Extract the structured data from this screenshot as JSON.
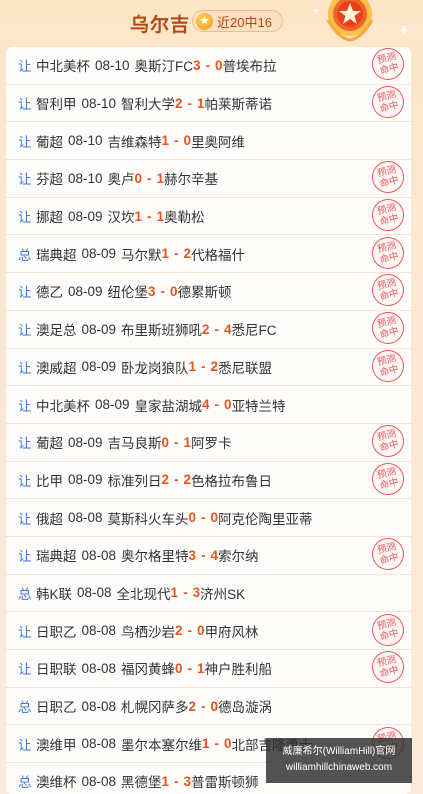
{
  "header": {
    "title": "乌尔吉",
    "badge_label": "近20中16",
    "badge_icon": "star-icon"
  },
  "rows": [
    {
      "kind": "让",
      "league": "中北美杯",
      "date": "08-10",
      "home": "奥斯汀FC",
      "hs": "3",
      "as": "0",
      "away": "普埃布拉",
      "hit": true
    },
    {
      "kind": "让",
      "league": "智利甲",
      "date": "08-10",
      "home": "智利大学",
      "hs": "2",
      "as": "1",
      "away": "帕莱斯蒂诺",
      "hit": true
    },
    {
      "kind": "让",
      "league": "葡超",
      "date": "08-10",
      "home": "吉维森特",
      "hs": "1",
      "as": "0",
      "away": "里奥阿维",
      "hit": false
    },
    {
      "kind": "让",
      "league": "芬超",
      "date": "08-10",
      "home": "奥卢",
      "hs": "0",
      "as": "1",
      "away": "赫尔辛基",
      "hit": true
    },
    {
      "kind": "让",
      "league": "挪超",
      "date": "08-09",
      "home": "汉坎",
      "hs": "1",
      "as": "1",
      "away": "奥勒松",
      "hit": true
    },
    {
      "kind": "总",
      "league": "瑞典超",
      "date": "08-09",
      "home": "马尔默",
      "hs": "1",
      "as": "2",
      "away": "代格福什",
      "hit": true
    },
    {
      "kind": "让",
      "league": "德乙",
      "date": "08-09",
      "home": "纽伦堡",
      "hs": "3",
      "as": "0",
      "away": "德累斯顿",
      "hit": true
    },
    {
      "kind": "让",
      "league": "澳足总",
      "date": "08-09",
      "home": "布里斯班狮吼",
      "hs": "2",
      "as": "4",
      "away": "悉尼FC",
      "hit": true
    },
    {
      "kind": "让",
      "league": "澳威超",
      "date": "08-09",
      "home": "卧龙岗狼队",
      "hs": "1",
      "as": "2",
      "away": "悉尼联盟",
      "hit": true
    },
    {
      "kind": "让",
      "league": "中北美杯",
      "date": "08-09",
      "home": "皇家盐湖城",
      "hs": "4",
      "as": "0",
      "away": "亚特兰特",
      "hit": false
    },
    {
      "kind": "让",
      "league": "葡超",
      "date": "08-09",
      "home": "吉马良斯",
      "hs": "0",
      "as": "1",
      "away": "阿罗卡",
      "hit": true
    },
    {
      "kind": "让",
      "league": "比甲",
      "date": "08-09",
      "home": "标准列日",
      "hs": "2",
      "as": "2",
      "away": "色格拉布鲁日",
      "hit": true
    },
    {
      "kind": "让",
      "league": "俄超",
      "date": "08-08",
      "home": "莫斯科火车头",
      "hs": "0",
      "as": "0",
      "away": "阿克伦陶里亚蒂",
      "hit": false
    },
    {
      "kind": "让",
      "league": "瑞典超",
      "date": "08-08",
      "home": "奥尔格里特",
      "hs": "3",
      "as": "4",
      "away": "索尔纳",
      "hit": true
    },
    {
      "kind": "总",
      "league": "韩K联",
      "date": "08-08",
      "home": "全北现代",
      "hs": "1",
      "as": "3",
      "away": "济州SK",
      "hit": false
    },
    {
      "kind": "让",
      "league": "日职乙",
      "date": "08-08",
      "home": "鸟栖沙岩",
      "hs": "2",
      "as": "0",
      "away": "甲府风林",
      "hit": true
    },
    {
      "kind": "让",
      "league": "日职联",
      "date": "08-08",
      "home": "福冈黄蜂",
      "hs": "0",
      "as": "1",
      "away": "神户胜利船",
      "hit": true
    },
    {
      "kind": "总",
      "league": "日职乙",
      "date": "08-08",
      "home": "札幌冈萨多",
      "hs": "2",
      "as": "0",
      "away": "德岛漩涡",
      "hit": false
    },
    {
      "kind": "让",
      "league": "澳维甲",
      "date": "08-08",
      "home": "墨尔本塞尔维",
      "hs": "1",
      "as": "0",
      "away": "北部吉隆勇士",
      "hit": true
    },
    {
      "kind": "总",
      "league": "澳维杯",
      "date": "08-08",
      "home": "黑德堡",
      "hs": "1",
      "as": "3",
      "away": "普雷斯顿狮",
      "hit": false
    }
  ],
  "stamp": {
    "line1": "预测",
    "line2": "命中"
  },
  "watermark": {
    "line1": "威廉希尔(WilliamHill)官网",
    "line2": "williamhillchinaweb.com"
  },
  "colors": {
    "accent": "#e8541c",
    "title": "#b4470e",
    "kind": "#3a7bd5",
    "stamp": "#e85a5a"
  }
}
